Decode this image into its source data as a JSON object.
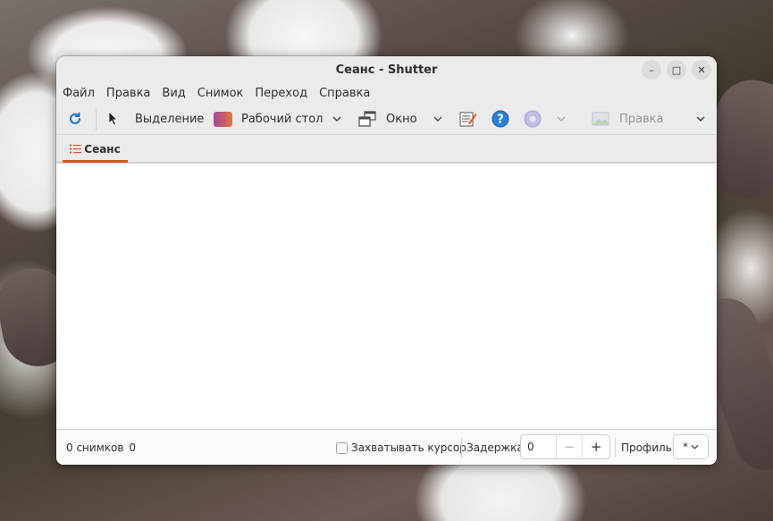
{
  "window": {
    "title": "Сеанс - Shutter",
    "controls": {
      "minimize": "–",
      "maximize": "□",
      "close": "✕"
    }
  },
  "menu": [
    "Файл",
    "Правка",
    "Вид",
    "Снимок",
    "Переход",
    "Справка"
  ],
  "toolbar": {
    "selection_label": "Выделение",
    "desktop_label": "Рабочий стол",
    "window_label": "Окно",
    "edit_label": "Правка",
    "icons": {
      "refresh": "refresh-icon",
      "selection": "cursor-arrow-icon",
      "desktop": "desktop-gradient-icon",
      "window": "windows-stack-icon",
      "menu": "menu-edit-icon",
      "tooltip": "help-icon",
      "web": "web-disc-icon",
      "edit": "image-edit-icon"
    },
    "colors": {
      "refresh": "#1a73c9",
      "help": "#2a7fd4",
      "accent": "#e95420"
    }
  },
  "tabs": [
    {
      "label": "Сеанс",
      "icon": "list-icon",
      "active": true
    }
  ],
  "status": {
    "count_text": "0 снимков",
    "count_size": "0",
    "capture_cursor_label": "Захватывать курсор",
    "capture_cursor_checked": false,
    "delay_label": "Задержка:",
    "delay_value": "0",
    "delay_minus": "−",
    "delay_plus": "+",
    "profile_label": "Профиль:",
    "profile_value": "*"
  }
}
